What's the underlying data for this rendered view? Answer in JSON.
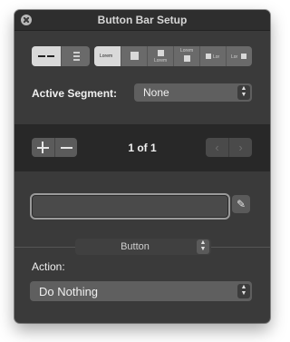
{
  "window": {
    "title": "Button Bar Setup"
  },
  "style_segments": [
    {
      "name": "text-only",
      "caption": "Lorem"
    },
    {
      "name": "icon-only",
      "caption": ""
    },
    {
      "name": "icon-above-text",
      "caption": "Lorem"
    },
    {
      "name": "text-above-icon",
      "caption": "Lorem"
    },
    {
      "name": "icon-left-text",
      "caption": "Lor"
    },
    {
      "name": "text-left-icon",
      "caption": "Lor"
    }
  ],
  "active_segment": {
    "label": "Active Segment:",
    "value": "None"
  },
  "pager": {
    "text": "1 of 1",
    "add_symbol": "+",
    "remove_symbol": "—",
    "prev": "‹",
    "next": "›"
  },
  "button_field": {
    "value": ""
  },
  "button_popup": {
    "value": "Button"
  },
  "action": {
    "label": "Action:",
    "value": "Do Nothing"
  },
  "colors": {
    "window_bg": "#3a3a3a",
    "band_bg": "#282828",
    "selected_segment": "#d9d9d9"
  }
}
